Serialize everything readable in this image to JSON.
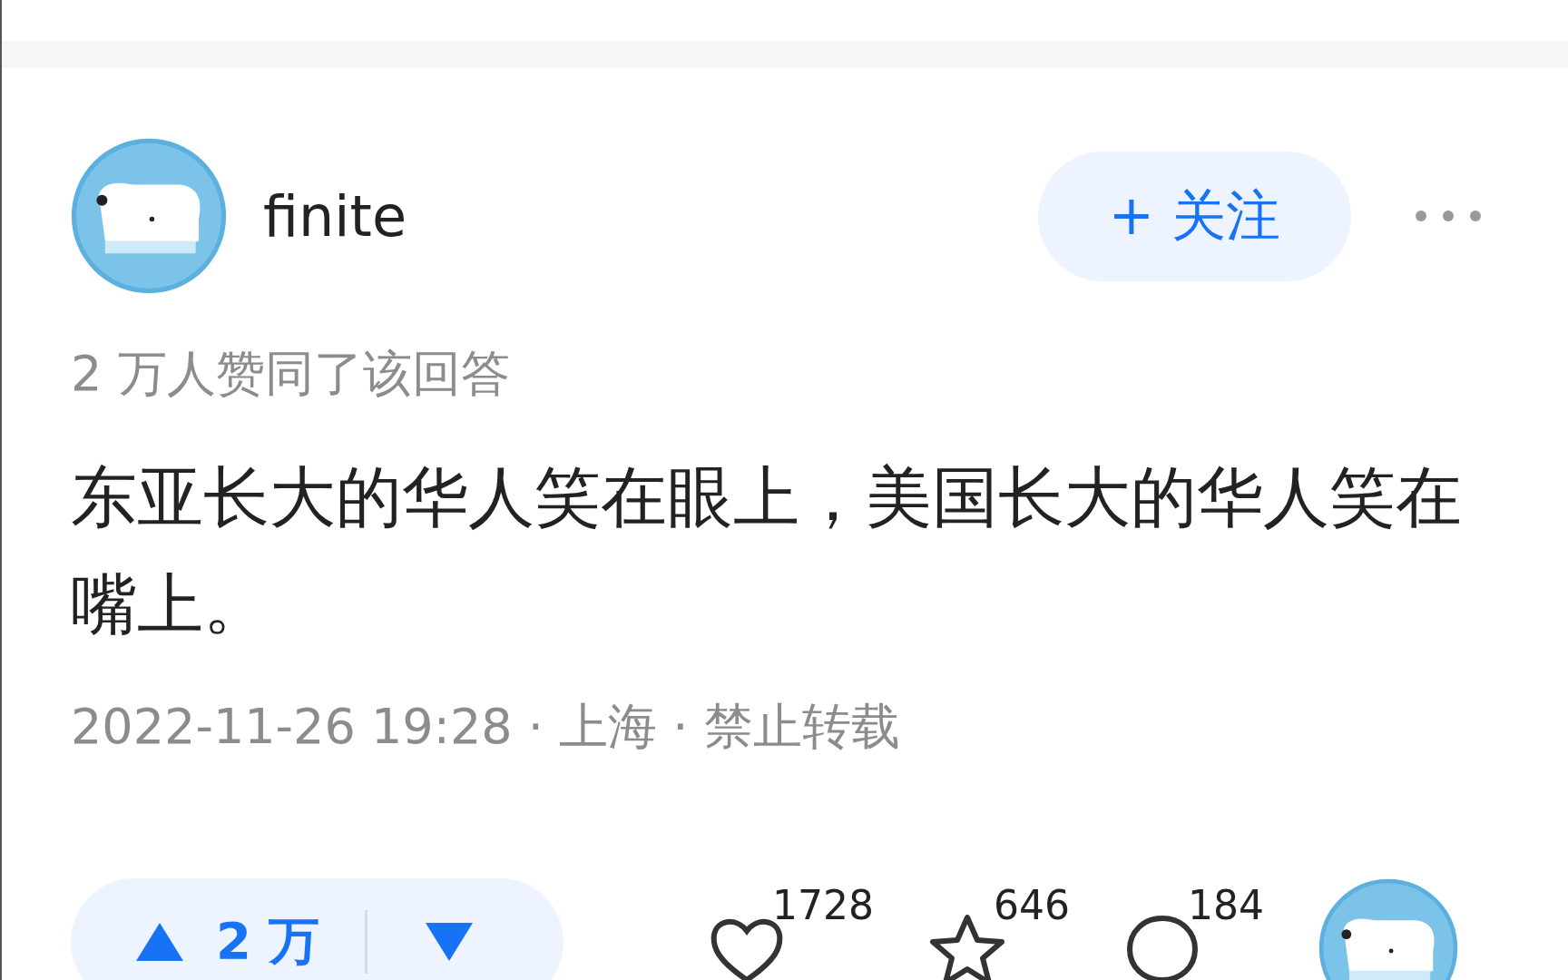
{
  "author": {
    "name": "finite"
  },
  "follow_button": {
    "label": "+ 关注"
  },
  "approval": "2 万人赞同了该回答",
  "content": "东亚长大的华人笑在眼上，美国长大的华人笑在嘴上。",
  "meta": "2022-11-26 19:28 · 上海 · 禁止转载",
  "vote": {
    "count": "2 万"
  },
  "actions": [
    {
      "kind": "like",
      "count": "1728"
    },
    {
      "kind": "favorite",
      "count": "646"
    },
    {
      "kind": "comment",
      "count": "184"
    }
  ]
}
